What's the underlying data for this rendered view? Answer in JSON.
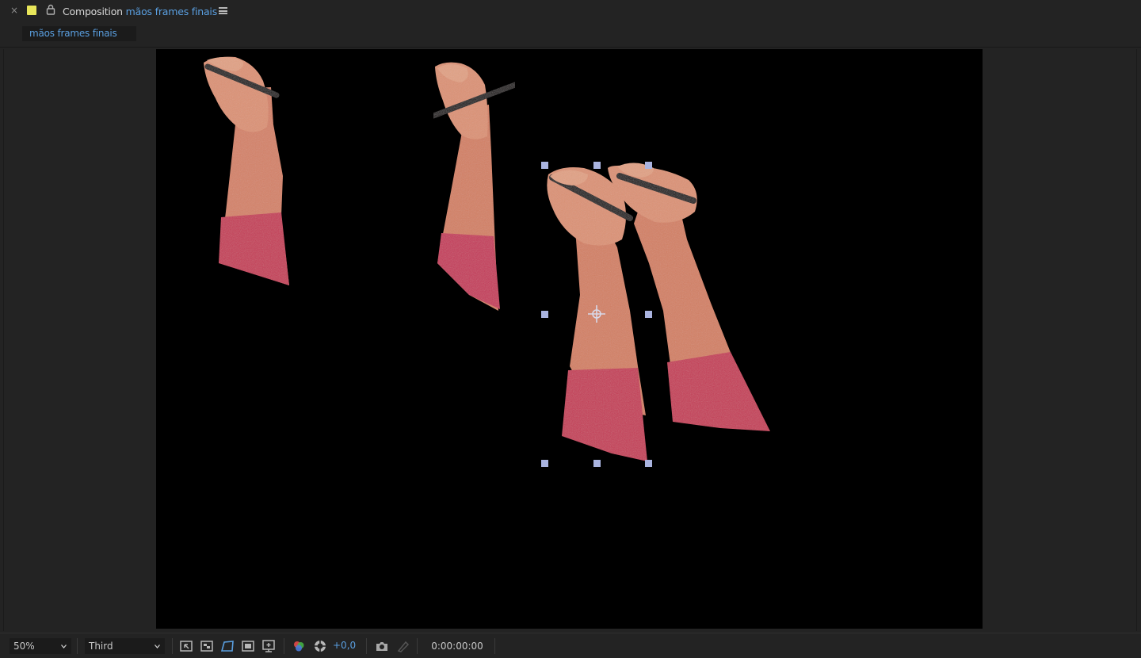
{
  "panel": {
    "title_prefix": "Composition",
    "comp_name": "mãos frames finais",
    "close_icon": "close-icon",
    "lock_icon": "lock-icon",
    "menu_icon": "hamburger-menu-icon"
  },
  "tab": {
    "label": "mãos frames finais"
  },
  "colors": {
    "label_swatch": "#e8e65a",
    "accent_blue": "#5a9fe0",
    "canvas_bg": "#000000",
    "sleeve": "#c83a5a",
    "skin": "#d98a6c",
    "handle": "#aab4e0"
  },
  "toolbar": {
    "zoom": "50%",
    "resolution": "Third",
    "icons": [
      "region-of-interest-icon",
      "transparency-grid-icon",
      "mask-path-icon",
      "safe-margins-icon",
      "view-options-icon",
      "color-channels-icon",
      "reset-exposure-icon",
      "snapshot-icon",
      "show-snapshot-icon"
    ],
    "exposure": "+0,0",
    "timecode": "0:00:00:00"
  }
}
